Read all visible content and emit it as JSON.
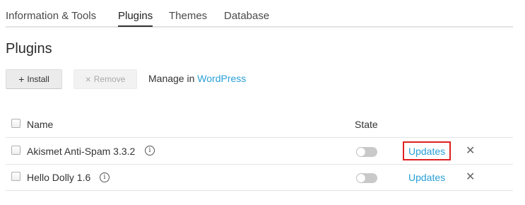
{
  "tabs": [
    {
      "label": "Information & Tools"
    },
    {
      "label": "Plugins"
    },
    {
      "label": "Themes"
    },
    {
      "label": "Database"
    }
  ],
  "page_title": "Plugins",
  "toolbar": {
    "install_label": "Install",
    "install_icon": "plus-icon",
    "remove_label": "Remove",
    "remove_icon": "close-icon",
    "manage_prefix": "Manage in",
    "manage_link": "WordPress"
  },
  "table": {
    "columns": {
      "name": "Name",
      "state": "State"
    },
    "rows": [
      {
        "name": "Akismet Anti-Spam 3.3.2",
        "enabled": false,
        "action": "Updates",
        "highlighted": true
      },
      {
        "name": "Hello Dolly 1.6",
        "enabled": false,
        "action": "Updates",
        "highlighted": false
      }
    ]
  },
  "colors": {
    "link": "#2a9fd6",
    "highlight": "#e02020",
    "toggle_off": "#c9c9c9"
  }
}
